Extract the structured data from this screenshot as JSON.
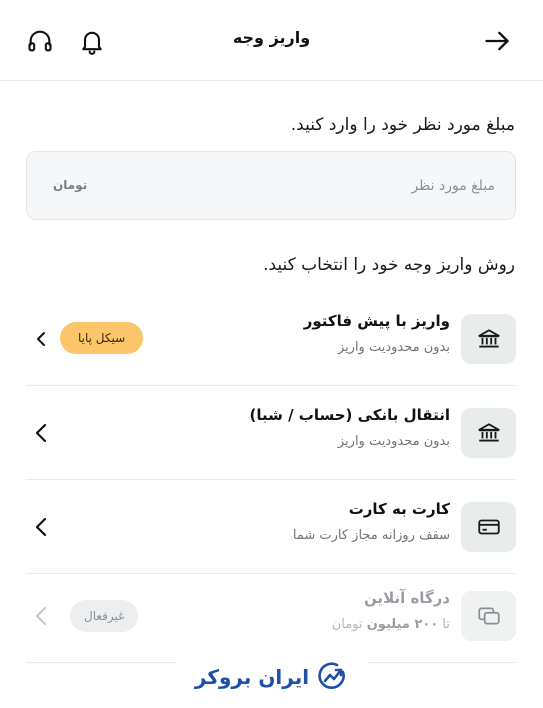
{
  "header": {
    "title": "واریز وجه",
    "back_icon": "arrow-right-icon",
    "notification_icon": "bell-icon",
    "support_icon": "headphones-icon"
  },
  "amount": {
    "label": "مبلغ مورد نظر خود را وارد کنید.",
    "placeholder": "مبلغ مورد نظر",
    "value": "",
    "unit": "تومان"
  },
  "methods_label": "روش واریز وجه خود را انتخاب کنید.",
  "methods": [
    {
      "title": "واریز با پیش فاکتور",
      "subtitle": "بدون محدودیت واریز",
      "badge": "سیکل پایا",
      "icon": "bank-icon",
      "enabled": true
    },
    {
      "title": "انتقال بانکی (حساب / شبا)",
      "subtitle": "بدون محدودیت واریز",
      "icon": "bank-icon",
      "enabled": true
    },
    {
      "title": "کارت به کارت",
      "subtitle": "سقف روزانه مجاز کارت شما",
      "icon": "card-icon",
      "enabled": true
    },
    {
      "title": "درگاه آنلاین",
      "subtitle_prefix": "تا",
      "subtitle_bold": "۲۰۰ میلیون",
      "subtitle_suffix": "تومان",
      "badge": "غیرفعال",
      "icon": "gateway-icon",
      "enabled": false
    }
  ],
  "brand": {
    "name": "ایران بروکر",
    "icon": "brand-chart-icon"
  },
  "colors": {
    "badge_gold": "#fbc56a",
    "brand_blue": "#1f4fa8",
    "icon_bg": "#e8eceb"
  }
}
